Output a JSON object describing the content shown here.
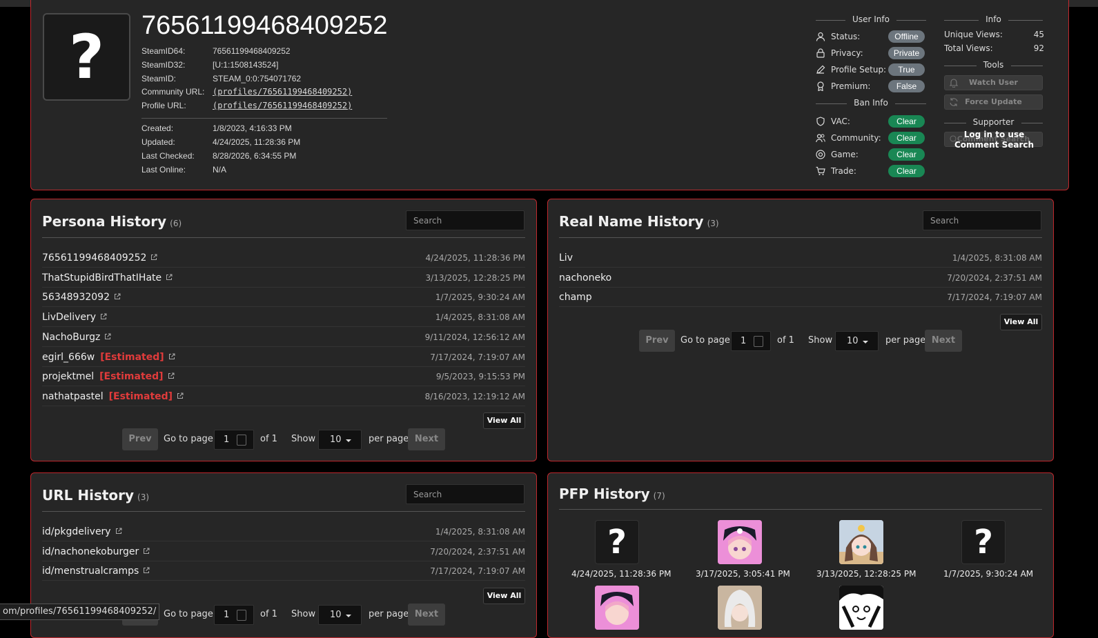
{
  "profile": {
    "steamid_title": "76561199468409252",
    "avatar_glyph": "?",
    "fields": [
      {
        "label": "SteamID64:",
        "value": "76561199468409252"
      },
      {
        "label": "SteamID32:",
        "value": "[U:1:1508143524]"
      },
      {
        "label": "SteamID:",
        "value": "STEAM_0:0:754071762"
      },
      {
        "label": "Community URL:",
        "value": "(profiles/76561199468409252)"
      },
      {
        "label": "Profile URL:",
        "value": "(profiles/76561199468409252)"
      }
    ],
    "dates": [
      {
        "label": "Created:",
        "value": "1/8/2023, 4:16:33 PM"
      },
      {
        "label": "Updated:",
        "value": "4/24/2025, 11:28:36 PM"
      },
      {
        "label": "Last Checked:",
        "value": "8/28/2026, 6:34:55 PM"
      },
      {
        "label": "Last Online:",
        "value": "N/A"
      }
    ]
  },
  "user_info": {
    "title": "User Info",
    "rows": [
      {
        "label": "Status:",
        "value": "Offline",
        "icon": "user-icon"
      },
      {
        "label": "Privacy:",
        "value": "Private",
        "icon": "lock-icon"
      },
      {
        "label": "Profile Setup:",
        "value": "True",
        "icon": "pencil-icon"
      },
      {
        "label": "Premium:",
        "value": "False",
        "icon": "award-icon"
      }
    ]
  },
  "ban_info": {
    "title": "Ban Info",
    "rows": [
      {
        "label": "VAC:",
        "value": "Clear",
        "icon": "shield-icon"
      },
      {
        "label": "Community:",
        "value": "Clear",
        "icon": "users-icon"
      },
      {
        "label": "Game:",
        "value": "Clear",
        "icon": "target-icon"
      },
      {
        "label": "Trade:",
        "value": "Clear",
        "icon": "cart-icon"
      }
    ]
  },
  "info": {
    "title": "Info",
    "unique_views_label": "Unique Views:",
    "unique_views": "45",
    "total_views_label": "Total Views:",
    "total_views": "92"
  },
  "tools": {
    "title": "Tools",
    "watch_user": "Watch User",
    "force_update": "Force Update"
  },
  "supporter": {
    "title": "Supporter",
    "comment_search": "Comment Search",
    "login_notice": "Log in to use Comment Search"
  },
  "persona": {
    "title": "Persona History",
    "count": "(6)",
    "search_placeholder": "Search",
    "estimated_label": "[Estimated]",
    "rows": [
      {
        "name": "76561199468409252",
        "date": "4/24/2025, 11:28:36 PM"
      },
      {
        "name": "ThatStupidBirdThatIHate",
        "date": "3/13/2025, 12:28:25 PM"
      },
      {
        "name": "56348932092",
        "date": "1/7/2025, 9:30:24 AM"
      },
      {
        "name": "LivDelivery",
        "date": "1/4/2025, 8:31:08 AM"
      },
      {
        "name": "NachoBurgz",
        "date": "9/11/2024, 12:56:12 AM"
      },
      {
        "name": "egirl_666w",
        "date": "7/17/2024, 7:19:07 AM",
        "estimated": true
      },
      {
        "name": "projektmel",
        "date": "9/5/2023, 9:15:53 PM",
        "estimated": true
      },
      {
        "name": "nathatpastel",
        "date": "8/16/2023, 12:19:12 AM",
        "estimated": true
      }
    ],
    "view_all": "View All"
  },
  "realname": {
    "title": "Real Name History",
    "count": "(3)",
    "search_placeholder": "Search",
    "rows": [
      {
        "name": "Liv",
        "date": "1/4/2025, 8:31:08 AM"
      },
      {
        "name": "nachoneko",
        "date": "7/20/2024, 2:37:51 AM"
      },
      {
        "name": "champ",
        "date": "7/17/2024, 7:19:07 AM"
      }
    ],
    "view_all": "View All"
  },
  "url_history": {
    "title": "URL History",
    "count": "(3)",
    "search_placeholder": "Search",
    "rows": [
      {
        "name": "id/pkgdelivery",
        "date": "1/4/2025, 8:31:08 AM"
      },
      {
        "name": "id/nachonekoburger",
        "date": "7/20/2024, 2:37:51 AM"
      },
      {
        "name": "id/menstrualcramps",
        "date": "7/17/2024, 7:19:07 AM"
      }
    ],
    "view_all": "View All"
  },
  "pfp": {
    "title": "PFP History",
    "count": "(7)",
    "items": [
      {
        "date": "4/24/2025, 11:28:36 PM"
      },
      {
        "date": "3/17/2025, 3:05:41 PM"
      },
      {
        "date": "3/13/2025, 12:28:25 PM"
      },
      {
        "date": "1/7/2025, 9:30:24 AM"
      }
    ]
  },
  "pager": {
    "prev": "Prev",
    "goto": "Go to page:",
    "page": "1",
    "of": "of 1",
    "show": "Show",
    "per_page_value": "10",
    "per_page": "per page",
    "next": "Next"
  },
  "statusbar": {
    "url": "om/profiles/76561199468409252/"
  },
  "colors": {
    "accent_border": "#c0282d",
    "clear_green": "#198754",
    "neutral_pill": "#6c757d",
    "estimated_red": "#e03b3b"
  }
}
